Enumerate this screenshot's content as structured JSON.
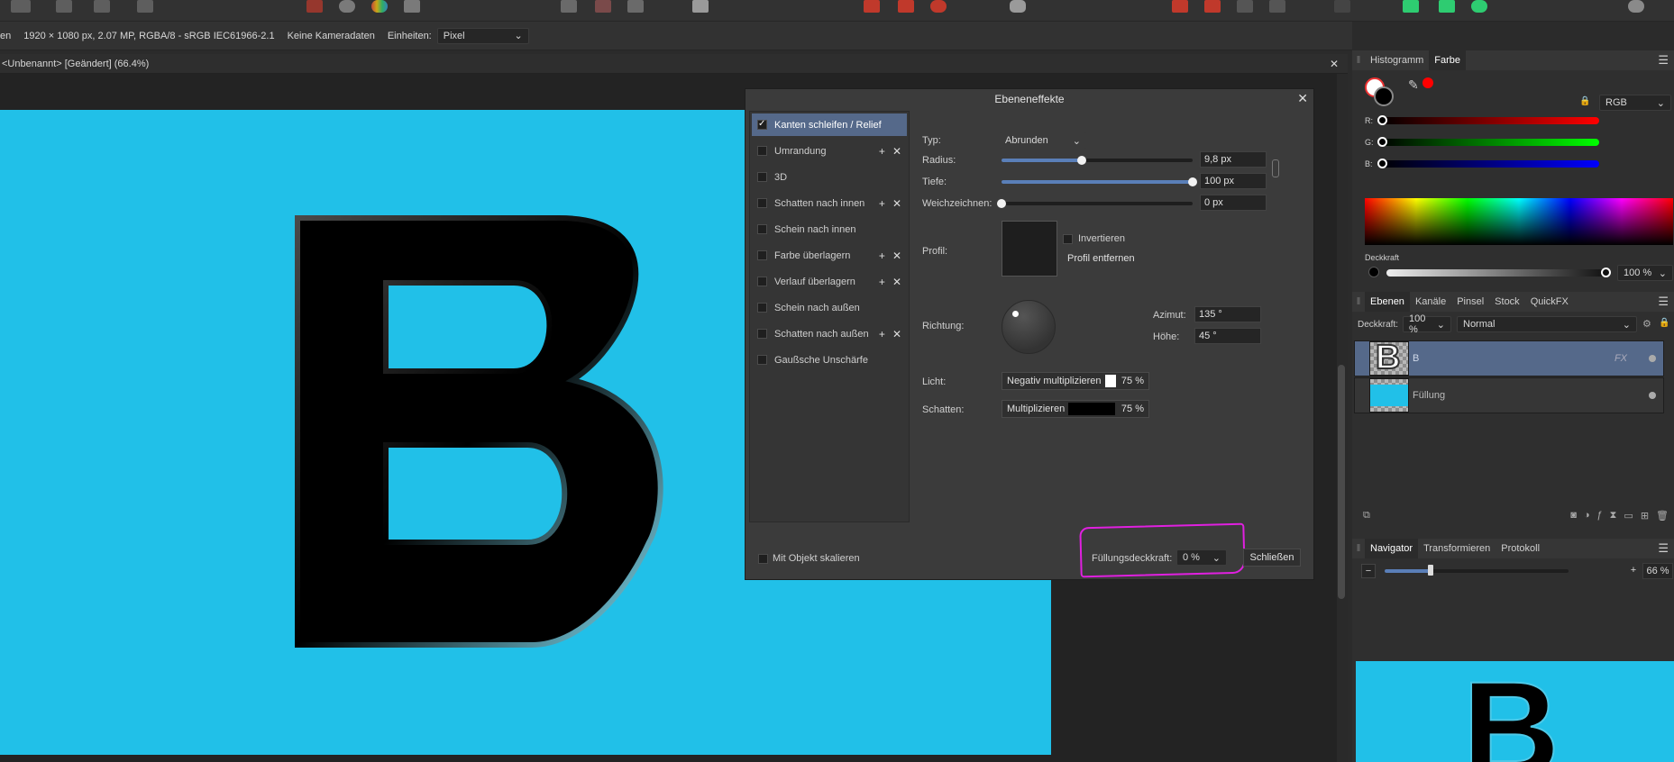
{
  "context_bar": {
    "cut_label": "en",
    "doc_info": "1920 × 1080 px, 2.07 MP, RGBA/8 - sRGB IEC61966-2.1",
    "camera": "Keine Kameradaten",
    "units_label": "Einheiten:",
    "units_value": "Pixel"
  },
  "document_tab": {
    "title": "<Unbenannt> [Geändert] (66.4%)"
  },
  "canvas": {
    "letter": "B",
    "background_color": "#21c0e8"
  },
  "dialog": {
    "title": "Ebeneneffekte",
    "effects": [
      {
        "label": "Kanten schleifen / Relief",
        "checked": true,
        "active": true,
        "addable": false
      },
      {
        "label": "Umrandung",
        "checked": false,
        "active": false,
        "addable": true
      },
      {
        "label": "3D",
        "checked": false,
        "active": false,
        "addable": false
      },
      {
        "label": "Schatten nach innen",
        "checked": false,
        "active": false,
        "addable": true
      },
      {
        "label": "Schein nach innen",
        "checked": false,
        "active": false,
        "addable": false
      },
      {
        "label": "Farbe überlagern",
        "checked": false,
        "active": false,
        "addable": true
      },
      {
        "label": "Verlauf überlagern",
        "checked": false,
        "active": false,
        "addable": true
      },
      {
        "label": "Schein nach außen",
        "checked": false,
        "active": false,
        "addable": false
      },
      {
        "label": "Schatten nach außen",
        "checked": false,
        "active": false,
        "addable": true
      },
      {
        "label": "Gaußsche Unschärfe",
        "checked": false,
        "active": false,
        "addable": false
      }
    ],
    "props": {
      "type_label": "Typ:",
      "type_value": "Abrunden",
      "radius_label": "Radius:",
      "radius_value": "9,8 px",
      "radius_fraction": 0.42,
      "depth_label": "Tiefe:",
      "depth_value": "100 px",
      "depth_fraction": 1.0,
      "blur_label": "Weichzeichnen:",
      "blur_value": "0 px",
      "blur_fraction": 0.0,
      "profile_label": "Profil:",
      "invert_label": "Invertieren",
      "remove_profile_label": "Profil entfernen",
      "direction_label": "Richtung:",
      "azimuth_label": "Azimut:",
      "azimuth_value": "135 °",
      "altitude_label": "Höhe:",
      "altitude_value": "45 °",
      "light_label": "Licht:",
      "light_mode": "Negativ multiplizieren",
      "light_color": "#ffffff",
      "light_opacity": "75 %",
      "shadow_label": "Schatten:",
      "shadow_mode": "Multiplizieren",
      "shadow_color": "#000000",
      "shadow_opacity": "75 %"
    },
    "scale_with_object_label": "Mit Objekt skalieren",
    "fill_opacity_label": "Füllungsdeckkraft:",
    "fill_opacity_value": "0 %",
    "close_button": "Schließen"
  },
  "color_panel": {
    "tabs": [
      "Histogramm",
      "Farbe"
    ],
    "active_tab": "Farbe",
    "model": "RGB",
    "channels": [
      {
        "label": "R:",
        "value": "0",
        "color": "#ff0000"
      },
      {
        "label": "G:",
        "value": "0",
        "color": "#00ff00"
      },
      {
        "label": "B:",
        "value": "0",
        "color": "#0000ff"
      }
    ],
    "opacity_label": "Deckkraft",
    "opacity_value": "100 %"
  },
  "layers_panel": {
    "tabs": [
      "Ebenen",
      "Kanäle",
      "Pinsel",
      "Stock",
      "QuickFX"
    ],
    "active_tab": "Ebenen",
    "opacity_label": "Deckkraft:",
    "opacity_value": "100 %",
    "blend_mode": "Normal",
    "layers": [
      {
        "name": "B",
        "selected": true,
        "has_fx": true,
        "fx_label": "FX"
      },
      {
        "name": "Füllung",
        "selected": false,
        "has_fx": false,
        "fx_label": ""
      }
    ]
  },
  "navigator_panel": {
    "tabs": [
      "Navigator",
      "Transformieren",
      "Protokoll"
    ],
    "active_tab": "Navigator",
    "zoom_value": "66 %",
    "zoom_fraction": 0.25,
    "preview_letter": "B"
  }
}
